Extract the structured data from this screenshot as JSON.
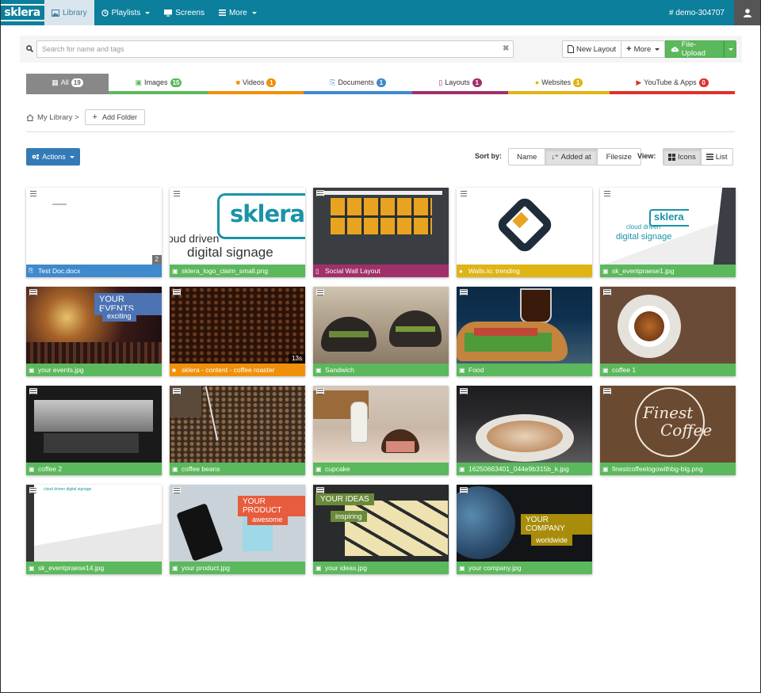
{
  "nav": {
    "brand": "sklera",
    "items": [
      {
        "label": "Library",
        "icon": "image-icon",
        "active": true
      },
      {
        "label": "Playlists",
        "icon": "clock-icon",
        "dropdown": true
      },
      {
        "label": "Screens",
        "icon": "monitor-icon"
      },
      {
        "label": "More",
        "icon": "list-icon",
        "dropdown": true
      }
    ],
    "account": "# demo-304707"
  },
  "search": {
    "placeholder": "Search for name and tags",
    "value": ""
  },
  "toolbar": {
    "new_layout": "New Layout",
    "more": "More",
    "upload": "File-Upload"
  },
  "tabs": [
    {
      "label": "All",
      "count": "19",
      "color": "#888888",
      "badge_color": "#ffffff",
      "active": true
    },
    {
      "label": "Images",
      "count": "15",
      "color": "#5cb85c",
      "badge_color": "#5cb85c"
    },
    {
      "label": "Videos",
      "count": "1",
      "color": "#f0900a",
      "badge_color": "#f0900a"
    },
    {
      "label": "Documents",
      "count": "1",
      "color": "#3e8acc",
      "badge_color": "#3e8acc"
    },
    {
      "label": "Layouts",
      "count": "1",
      "color": "#a0306a",
      "badge_color": "#a0306a"
    },
    {
      "label": "Websites",
      "count": "1",
      "color": "#dfb415",
      "badge_color": "#dfb415"
    },
    {
      "label": "YouTube & Apps",
      "count": "0",
      "color": "#e0302a",
      "badge_color": "#e0302a"
    }
  ],
  "breadcrumb": {
    "root": "My Library >",
    "add_folder": "Add Folder"
  },
  "actions": {
    "label": "Actions"
  },
  "sort": {
    "label": "Sort by:",
    "options": [
      "Name",
      "Added at",
      "Filesize"
    ],
    "selected": "Added at"
  },
  "view": {
    "label": "View:",
    "options": [
      "Icons",
      "List"
    ],
    "selected": "Icons"
  },
  "items": [
    {
      "name": "Test Doc.docx",
      "type": "document",
      "color": "#3e8acc",
      "tag": "2"
    },
    {
      "name": "sklera_logo_claim_small.png",
      "type": "image",
      "color": "#5cb85c"
    },
    {
      "name": "Social Wall Layout",
      "type": "layout",
      "color": "#a0306a"
    },
    {
      "name": "Walls.io: trending",
      "type": "website",
      "color": "#dfb415"
    },
    {
      "name": "sk_eventpraese1.jpg",
      "type": "image",
      "color": "#5cb85c"
    },
    {
      "name": "your events.jpg",
      "type": "image",
      "color": "#5cb85c"
    },
    {
      "name": "sklera - content - coffee roaster",
      "type": "video",
      "color": "#f0900a",
      "tag": "13s"
    },
    {
      "name": "Sandwich",
      "type": "image",
      "color": "#5cb85c"
    },
    {
      "name": "Food",
      "type": "image",
      "color": "#5cb85c"
    },
    {
      "name": "coffee 1",
      "type": "image",
      "color": "#5cb85c"
    },
    {
      "name": "coffee 2",
      "type": "image",
      "color": "#5cb85c"
    },
    {
      "name": "coffee beans",
      "type": "image",
      "color": "#5cb85c"
    },
    {
      "name": "cupcake",
      "type": "image",
      "color": "#5cb85c"
    },
    {
      "name": "16250663401_044e9b315b_k.jpg",
      "type": "image",
      "color": "#5cb85c"
    },
    {
      "name": "finestcoffeelogowithbg-big.png",
      "type": "image",
      "color": "#5cb85c"
    },
    {
      "name": "sk_eventpraese14.jpg",
      "type": "image",
      "color": "#5cb85c"
    },
    {
      "name": "your product.jpg",
      "type": "image",
      "color": "#5cb85c"
    },
    {
      "name": "your ideas.jpg",
      "type": "image",
      "color": "#5cb85c"
    },
    {
      "name": "your company.jpg",
      "type": "image",
      "color": "#5cb85c"
    }
  ],
  "thumb_text": {
    "sklera_logo_word": "sklera",
    "sklera_logo_claim1": "oud driven",
    "sklera_logo_claim2": "digital signage",
    "eventpraese_word": "sklera",
    "eventpraese_claim1": "cloud driven",
    "eventpraese_claim2": "digital signage",
    "events_title": "YOUR EVENTS",
    "events_sub": "exciting",
    "finest1": "Finest",
    "finest2": "Coffee",
    "ev14_claim": "cloud driven digital signage",
    "product_title": "YOUR PRODUCT",
    "product_sub": "awesome",
    "ideas_title": "YOUR IDEAS",
    "ideas_sub": "inspiring",
    "company_title": "YOUR COMPANY",
    "company_sub": "worldwide"
  }
}
